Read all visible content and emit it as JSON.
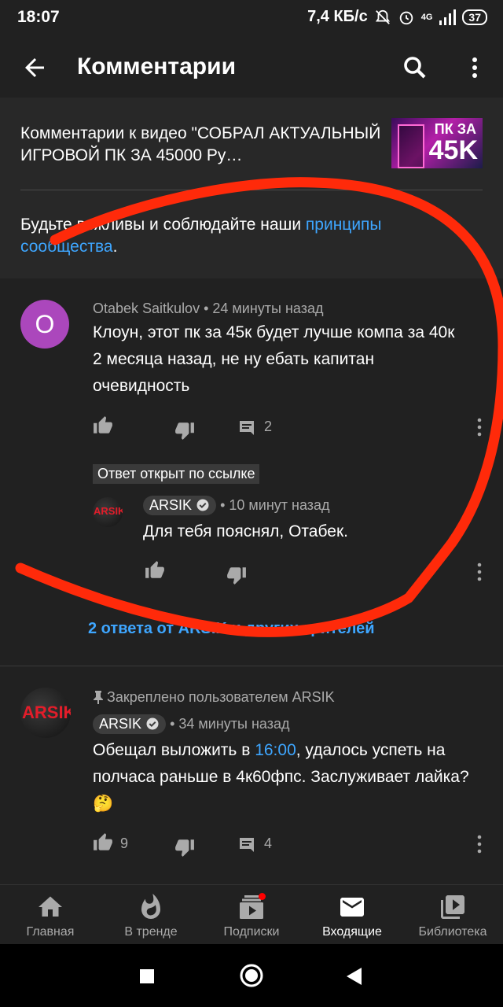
{
  "status_bar": {
    "time": "18:07",
    "speed": "7,4 КБ/с",
    "network": "4G",
    "battery": "37"
  },
  "app_bar": {
    "title": "Комментарии",
    "icons": [
      "arrow-back-icon",
      "search-icon",
      "more-vert-icon"
    ]
  },
  "video": {
    "title": "Комментарии к видео \"СОБРАЛ АКТУАЛЬНЫЙ ИГРОВОЙ ПК ЗА 45000 Ру…",
    "thumb_line1": "ПК ЗА",
    "thumb_line2": "45K"
  },
  "guidelines": {
    "text": "Будьте вежливы и соблюдайте наши ",
    "link": "принципы сообщества",
    "end": "."
  },
  "comment1": {
    "avatar_letter": "O",
    "author": "Otabek Saitkulov",
    "time": "• 24 минуты назад",
    "text": "Клоун, этот пк за 45к будет лучше компа за 40к 2 месяца назад, не ну ебать капитан очевидность",
    "reply_count": "2"
  },
  "linked_reply_chip": "Ответ открыт по ссылке",
  "reply": {
    "author": "ARSIK",
    "time": "• 10 минут назад",
    "text": "Для тебя пояснял, Отабек.",
    "avatar_text": "ARSIK"
  },
  "more_replies": "2 ответа от ARSIK и других зрителей",
  "comment2": {
    "pinned": "Закреплено пользователем ARSIK",
    "author": "ARSIK",
    "time": "• 34 минуты назад",
    "text_before": "Обещал выложить в ",
    "time_link": "16:00",
    "text_after": ", удалось успеть на полчаса раньше в 4к60фпс. Заслуживает лайка? 🤔",
    "likes": "9",
    "reply_count": "4",
    "avatar_text": "ARSIK"
  },
  "bottom_nav": [
    {
      "label": "Главная",
      "icon": "home-icon"
    },
    {
      "label": "В тренде",
      "icon": "fire-icon"
    },
    {
      "label": "Подписки",
      "icon": "subscriptions-icon"
    },
    {
      "label": "Входящие",
      "icon": "inbox-mail-icon"
    },
    {
      "label": "Библиотека",
      "icon": "library-icon"
    }
  ],
  "colors": {
    "background": "#212121",
    "link": "#3ea6ff",
    "scribble": "#ff2a0a",
    "avatar_purple": "#ab47bc"
  }
}
